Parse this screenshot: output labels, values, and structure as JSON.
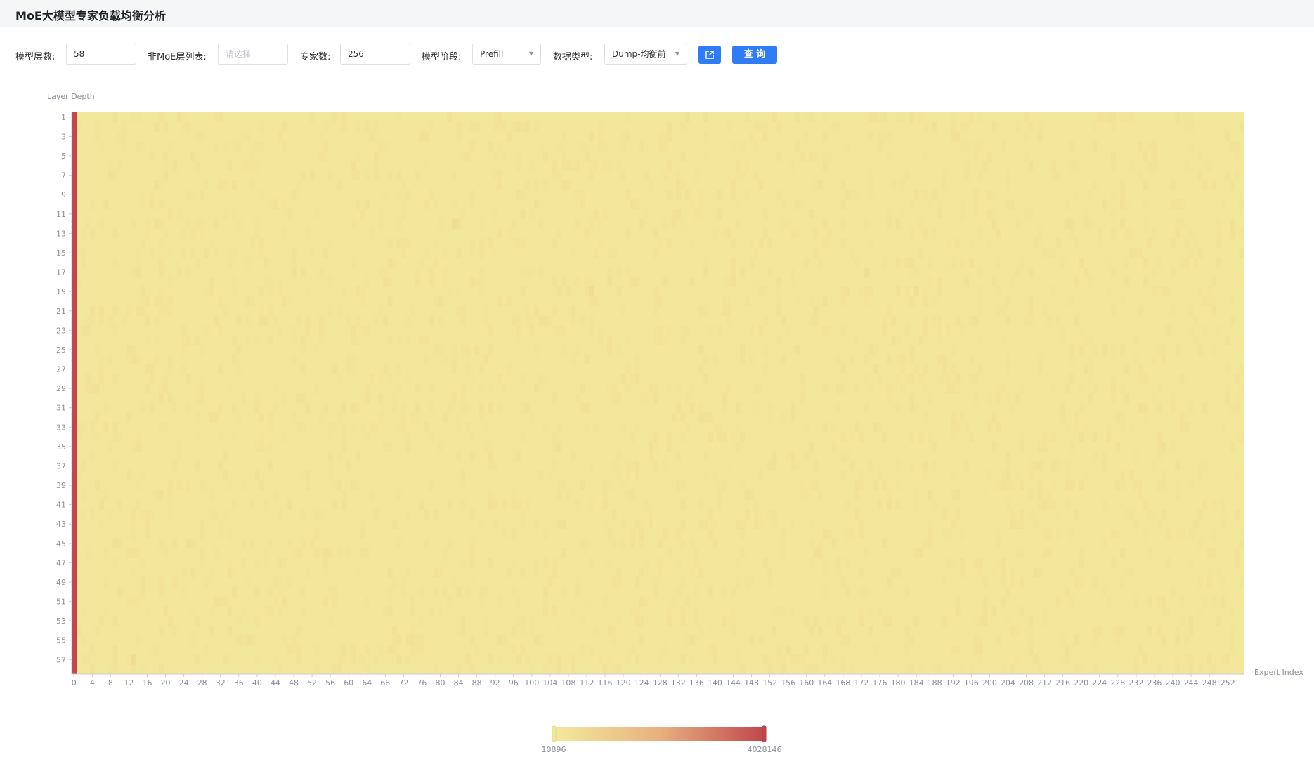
{
  "header": {
    "title": "MoE大模型专家负载均衡分析"
  },
  "toolbar": {
    "layers_label": "模型层数:",
    "layers_value": "58",
    "non_moe_label": "非MoE层列表:",
    "non_moe_placeholder": "请选择",
    "experts_label": "专家数:",
    "experts_value": "256",
    "stage_label": "模型阶段:",
    "stage_value": "Prefill",
    "datatype_label": "数据类型:",
    "datatype_value": "Dump-均衡前",
    "export_icon": "export-icon",
    "query_label": "查 询"
  },
  "colors": {
    "primary": "#2f7cf6",
    "heat_low": "#f3ea9c",
    "heat_mid": "#e8b17f",
    "heat_high": "#c0474d"
  },
  "chart_data": {
    "type": "heatmap",
    "ylabel": "Layer Depth",
    "xlabel": "Expert Index",
    "rows": 58,
    "cols": 256,
    "y_tick_labels": [
      "1",
      "3",
      "5",
      "7",
      "9",
      "11",
      "13",
      "15",
      "17",
      "19",
      "21",
      "23",
      "25",
      "27",
      "29",
      "31",
      "33",
      "35",
      "37",
      "39",
      "41",
      "43",
      "45",
      "47",
      "49",
      "51",
      "53",
      "55",
      "57"
    ],
    "x_tick_step": 4,
    "x_range": [
      0,
      255
    ],
    "visual_map": {
      "min": 10896,
      "max": 4028146,
      "min_label": "10896",
      "max_label": "4028146"
    },
    "base_value": 125000,
    "hot_column": {
      "expert": 0,
      "value": 4028146
    },
    "hotspots": [
      {
        "layer": 57,
        "expert": 13,
        "value": 560000
      },
      {
        "layer": 12,
        "expert": 83,
        "value": 480000
      },
      {
        "layer": 19,
        "expert": 113,
        "value": 470000
      },
      {
        "layer": 19,
        "expert": 184,
        "value": 440000
      },
      {
        "layer": 17,
        "expert": 173,
        "value": 400000
      },
      {
        "layer": 5,
        "expert": 26,
        "value": 330000
      },
      {
        "layer": 5,
        "expert": 234,
        "value": 320000
      },
      {
        "layer": 7,
        "expert": 52,
        "value": 310000
      },
      {
        "layer": 10,
        "expert": 17,
        "value": 300000
      },
      {
        "layer": 22,
        "expert": 41,
        "value": 300000
      },
      {
        "layer": 25,
        "expert": 183,
        "value": 290000
      }
    ]
  }
}
